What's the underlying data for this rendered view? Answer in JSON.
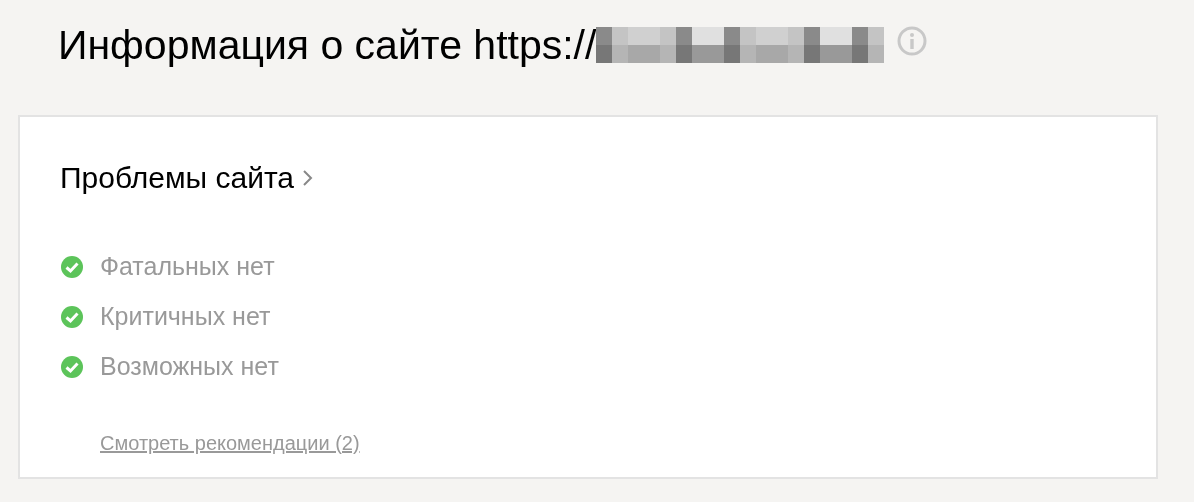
{
  "title": "Информация о сайте https://",
  "problems": {
    "heading": "Проблемы сайта",
    "items": [
      {
        "text": "Фатальных нет",
        "ok": true
      },
      {
        "text": "Критичных нет",
        "ok": true
      },
      {
        "text": "Возможных нет",
        "ok": true
      }
    ],
    "link": "Смотреть рекомендации (2)"
  }
}
